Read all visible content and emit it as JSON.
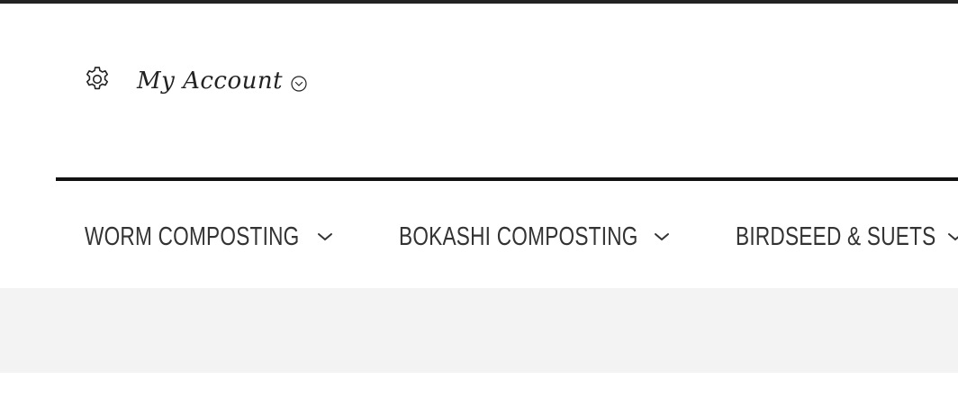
{
  "account": {
    "icon": "gear-icon",
    "label": "My Account",
    "caret_icon": "chevron-down-circle-icon"
  },
  "nav": {
    "items": [
      {
        "label": "WORM COMPOSTING",
        "icon": "chevron-down-icon"
      },
      {
        "label": "BOKASHI COMPOSTING",
        "icon": "chevron-down-icon"
      },
      {
        "label": "BIRDSEED & SUETS",
        "icon": "chevron-down-icon"
      }
    ]
  },
  "colors": {
    "text": "#333333",
    "divider": "#111111",
    "band": "#f3f3f3",
    "background": "#ffffff"
  }
}
